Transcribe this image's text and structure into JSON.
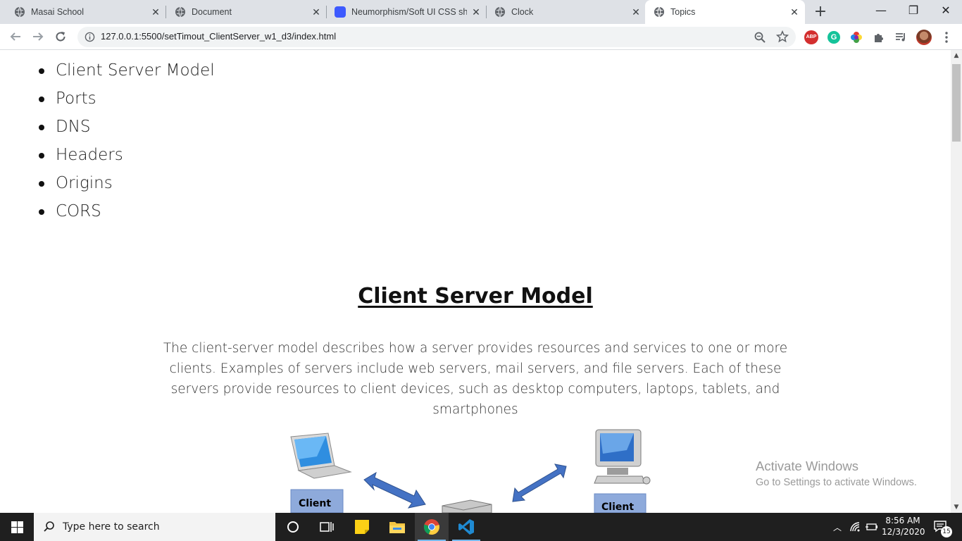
{
  "browser": {
    "tabs": [
      {
        "title": "Masai School",
        "icon": "globe-icon"
      },
      {
        "title": "Document",
        "icon": "globe-icon"
      },
      {
        "title": "Neumorphism/Soft UI CSS sha",
        "icon": "neumorphism-favicon"
      },
      {
        "title": "Clock",
        "icon": "globe-icon"
      },
      {
        "title": "Topics",
        "icon": "globe-icon",
        "active": true
      }
    ],
    "url": "127.0.0.1:5500/setTimout_ClientServer_w1_d3/index.html",
    "extensions": {
      "abp_label": "ABP",
      "grammarly_label": "G"
    }
  },
  "page": {
    "topics": [
      "Client Server Model",
      "Ports",
      "DNS",
      "Headers",
      "Origins",
      "CORS"
    ],
    "section_title": "Client Server Model",
    "section_description": "The client-server model describes how a server provides resources and services to one or more clients. Examples of servers include web servers, mail servers, and file servers. Each of these servers provide resources to client devices, such as desktop computers, laptops, tablets, and smartphones",
    "diagram": {
      "left_label": "Client",
      "right_label": "Client"
    }
  },
  "watermark": {
    "line1": "Activate Windows",
    "line2": "Go to Settings to activate Windows."
  },
  "taskbar": {
    "search_placeholder": "Type here to search",
    "time": "8:56 AM",
    "date": "12/3/2020",
    "notification_count": "15"
  },
  "colors": {
    "tabstrip": "#dee1e6",
    "taskbar": "#1f1f1f",
    "client_label_bg": "#8eaadb",
    "arrow": "#4472c4"
  }
}
